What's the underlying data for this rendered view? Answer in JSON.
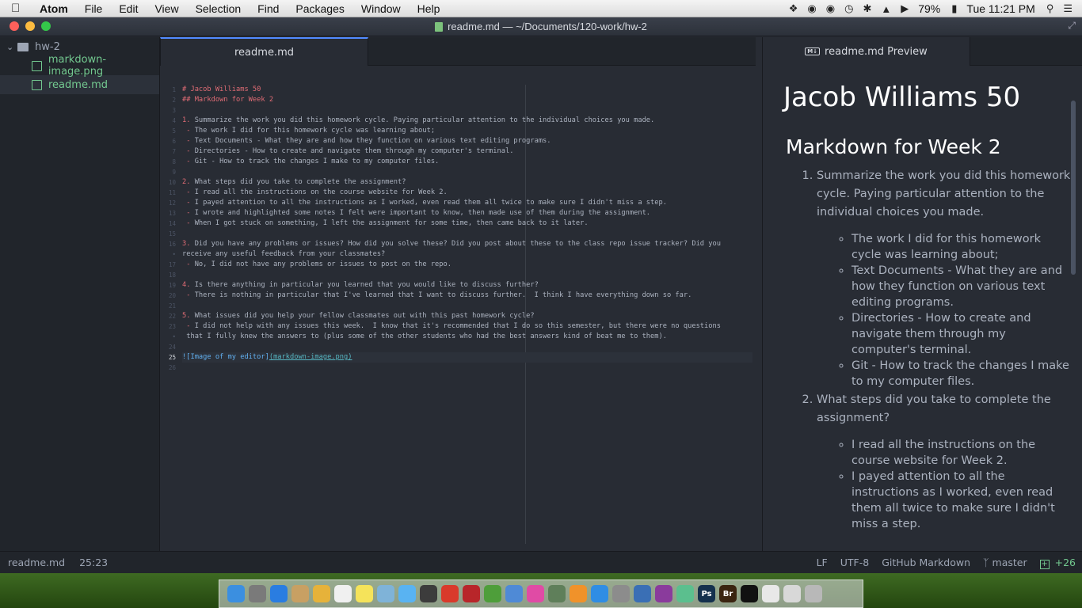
{
  "menubar": {
    "app_name": "Atom",
    "items": [
      "File",
      "Edit",
      "View",
      "Selection",
      "Find",
      "Packages",
      "Window",
      "Help"
    ],
    "battery": "79%",
    "clock": "Tue 11:21 PM"
  },
  "window": {
    "title": "readme.md — ~/Documents/120-work/hw-2",
    "traffic_lights": [
      "#fc605b",
      "#fdbc40",
      "#34c84a"
    ]
  },
  "tree": {
    "root": "hw-2",
    "files": [
      {
        "name": "markdown-image.png",
        "icon": "image-file-icon"
      },
      {
        "name": "readme.md",
        "icon": "book-file-icon"
      }
    ]
  },
  "editor": {
    "tab_title": "readme.md",
    "active_line": "25",
    "line_numbers": [
      "1",
      "2",
      "3",
      "4",
      "5",
      "6",
      "7",
      "8",
      "9",
      "10",
      "11",
      "12",
      "13",
      "14",
      "15",
      "16",
      "•",
      "17",
      "18",
      "19",
      "20",
      "21",
      "22",
      "23",
      "•",
      "24",
      "25",
      "26"
    ],
    "lines": [
      {
        "p": "# Jacob Williams 50",
        "r": ""
      },
      {
        "p": "## Markdown for Week 2",
        "r": ""
      },
      {
        "p": "",
        "r": ""
      },
      {
        "p": "1.",
        "r": " Summarize the work you did this homework cycle. Paying particular attention to the individual choices you made."
      },
      {
        "p": " -",
        "r": " The work I did for this homework cycle was learning about;"
      },
      {
        "p": " -",
        "r": " Text Documents - What they are and how they function on various text editing programs."
      },
      {
        "p": " -",
        "r": " Directories - How to create and navigate them through my computer's terminal."
      },
      {
        "p": " -",
        "r": " Git - How to track the changes I make to my computer files."
      },
      {
        "p": "",
        "r": ""
      },
      {
        "p": "2.",
        "r": " What steps did you take to complete the assignment?"
      },
      {
        "p": " -",
        "r": " I read all the instructions on the course website for Week 2."
      },
      {
        "p": " -",
        "r": " I payed attention to all the instructions as I worked, even read them all twice to make sure I didn't miss a step."
      },
      {
        "p": " -",
        "r": " I wrote and highlighted some notes I felt were important to know, then made use of them during the assignment."
      },
      {
        "p": " -",
        "r": " When I got stuck on something, I left the assignment for some time, then came back to it later."
      },
      {
        "p": "",
        "r": ""
      },
      {
        "p": "3.",
        "r": " Did you have any problems or issues? How did you solve these? Did you post about these to the class repo issue tracker? Did you"
      },
      {
        "p": "",
        "r": "receive any useful feedback from your classmates?"
      },
      {
        "p": " -",
        "r": " No, I did not have any problems or issues to post on the repo."
      },
      {
        "p": "",
        "r": ""
      },
      {
        "p": "4.",
        "r": " Is there anything in particular you learned that you would like to discuss further?"
      },
      {
        "p": " -",
        "r": " There is nothing in particular that I've learned that I want to discuss further.  I think I have everything down so far."
      },
      {
        "p": "",
        "r": ""
      },
      {
        "p": "5.",
        "r": " What issues did you help your fellow classmates out with this past homework cycle?"
      },
      {
        "p": " -",
        "r": " I did not help with any issues this week.  I know that it's recommended that I do so this semester, but there were no questions"
      },
      {
        "p": "",
        "r": " that I fully knew the answers to (plus some of the other students who had the best answers kind of beat me to them)."
      },
      {
        "p": "",
        "r": ""
      },
      {
        "p": "![Image of my editor]",
        "r": "(markdown-image.png)"
      },
      {
        "p": "",
        "r": ""
      }
    ]
  },
  "preview": {
    "tab_title": "readme.md Preview",
    "h1": "Jacob Williams 50",
    "h2": "Markdown for Week 2",
    "items": [
      {
        "text": "Summarize the work you did this homework cycle. Paying particular attention to the individual choices you made.",
        "bullets": [
          "The work I did for this homework cycle was learning about;",
          "Text Documents - What they are and how they function on various text editing programs.",
          "Directories - How to create and navigate them through my computer's terminal.",
          "Git - How to track the changes I make to my computer files."
        ]
      },
      {
        "text": "What steps did you take to complete the assignment?",
        "bullets": [
          "I read all the instructions on the course website for Week 2.",
          "I payed attention to all the instructions as I worked, even read them all twice to make sure I didn't miss a step."
        ]
      }
    ]
  },
  "statusbar": {
    "file": "readme.md",
    "cursor": "25:23",
    "line_ending": "LF",
    "encoding": "UTF-8",
    "grammar": "GitHub Markdown",
    "branch": "master",
    "diff": "+26"
  },
  "dock": {
    "apps": [
      {
        "icon": "finder-icon",
        "color": "#3b8fe0"
      },
      {
        "icon": "launchpad-icon",
        "color": "#7a7a7a"
      },
      {
        "icon": "safari-icon",
        "color": "#2a7de1"
      },
      {
        "icon": "contacts-icon",
        "color": "#c8a063"
      },
      {
        "icon": "notes-icon",
        "color": "#e6b23a"
      },
      {
        "icon": "calendar-icon",
        "color": "#f0f0f0"
      },
      {
        "icon": "stickies-icon",
        "color": "#f5e35a"
      },
      {
        "icon": "preview-icon",
        "color": "#7fb3d8"
      },
      {
        "icon": "messages-icon",
        "color": "#59b3f2"
      },
      {
        "icon": "facetime-icon",
        "color": "#3c3c3c"
      },
      {
        "icon": "creative-cloud-icon",
        "color": "#d93a2b"
      },
      {
        "icon": "photo-booth-icon",
        "color": "#b8262a"
      },
      {
        "icon": "numbers-icon",
        "color": "#4e9e3a"
      },
      {
        "icon": "keynote-icon",
        "color": "#4f8ad6"
      },
      {
        "icon": "itunes-icon",
        "color": "#e04ba5"
      },
      {
        "icon": "iphoto-icon",
        "color": "#5f7f5a"
      },
      {
        "icon": "ibooks-icon",
        "color": "#f0922a"
      },
      {
        "icon": "app-store-icon",
        "color": "#2f8de4"
      },
      {
        "icon": "system-preferences-icon",
        "color": "#8c8c8c"
      },
      {
        "icon": "quicktime-icon",
        "color": "#3a6fb5"
      },
      {
        "icon": "github-icon",
        "color": "#8a3b9c"
      },
      {
        "icon": "atom-icon",
        "color": "#5bbf8e"
      },
      {
        "icon": "photoshop-icon",
        "color": "#14304d",
        "label": "Ps"
      },
      {
        "icon": "bridge-icon",
        "color": "#3a2410",
        "label": "Br"
      },
      {
        "icon": "terminal-icon",
        "color": "#111111"
      },
      {
        "icon": "document-icon",
        "color": "#e8e8e8"
      },
      {
        "icon": "file-icon",
        "color": "#d8d8d8"
      },
      {
        "icon": "trash-icon",
        "color": "#b8b8b8"
      }
    ]
  }
}
